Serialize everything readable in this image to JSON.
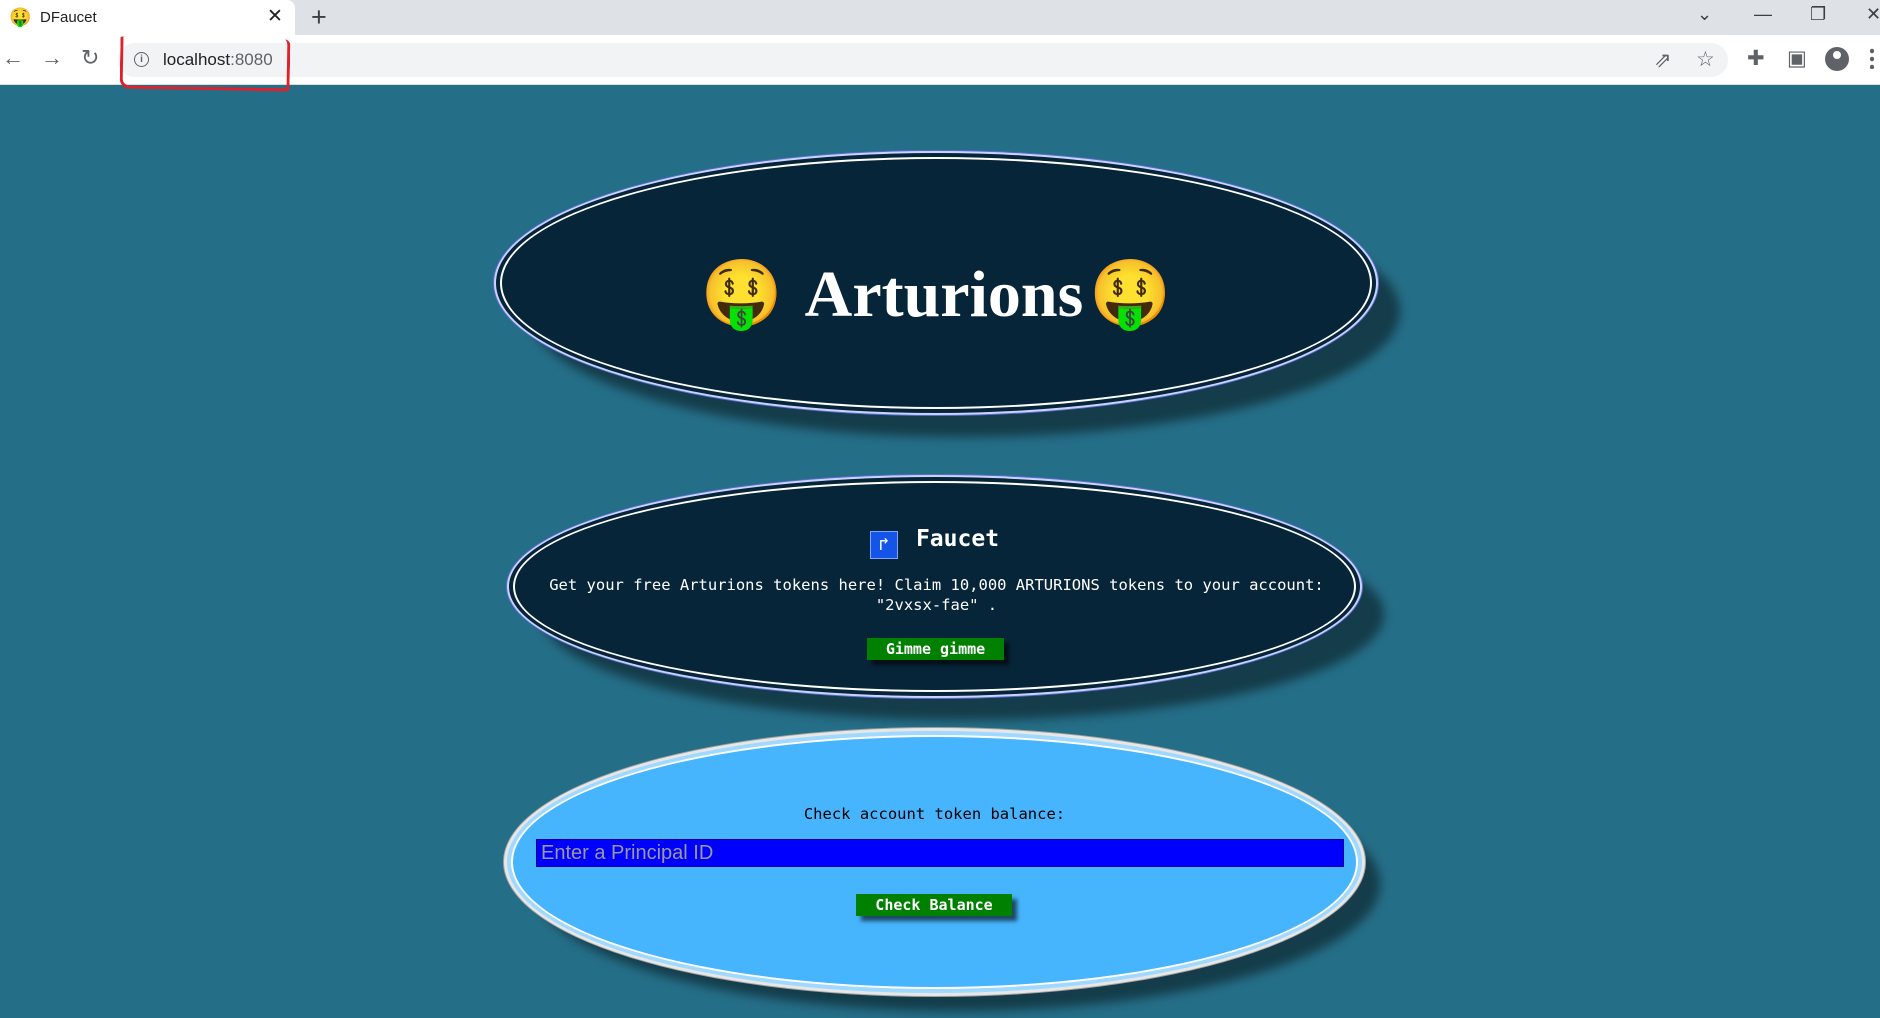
{
  "browser": {
    "tab_title": "DFaucet",
    "favicon": "🤑",
    "tab_close": "✕",
    "new_tab": "+",
    "url_host": "localhost",
    "url_port": ":8080",
    "icons": [
      "back-arrow-icon",
      "forward-arrow-icon",
      "reload-icon",
      "info-icon",
      "share-icon",
      "star-icon",
      "extensions-icon",
      "side-panel-icon",
      "profile-icon",
      "menu-icon"
    ]
  },
  "header": {
    "emoji_left": "🤑",
    "title": "Arturions",
    "emoji_right": "🤑"
  },
  "faucet": {
    "heading": "Faucet",
    "description": "Get your free Arturions tokens here! Claim 10,000 ARTURIONS tokens to your account:",
    "account": "\"2vxsx-fae\" .",
    "button_label": "Gimme gimme"
  },
  "balance": {
    "label": "Check account token balance:",
    "input_placeholder": "Enter a Principal ID",
    "button_label": "Check Balance"
  },
  "colors": {
    "page_background": "#256e87",
    "dark_ellipse": "#072539",
    "light_ellipse": "#47b5fd",
    "button_green": "#008000",
    "input_blue": "#0000ff",
    "annotation_red": "#e0202a"
  }
}
